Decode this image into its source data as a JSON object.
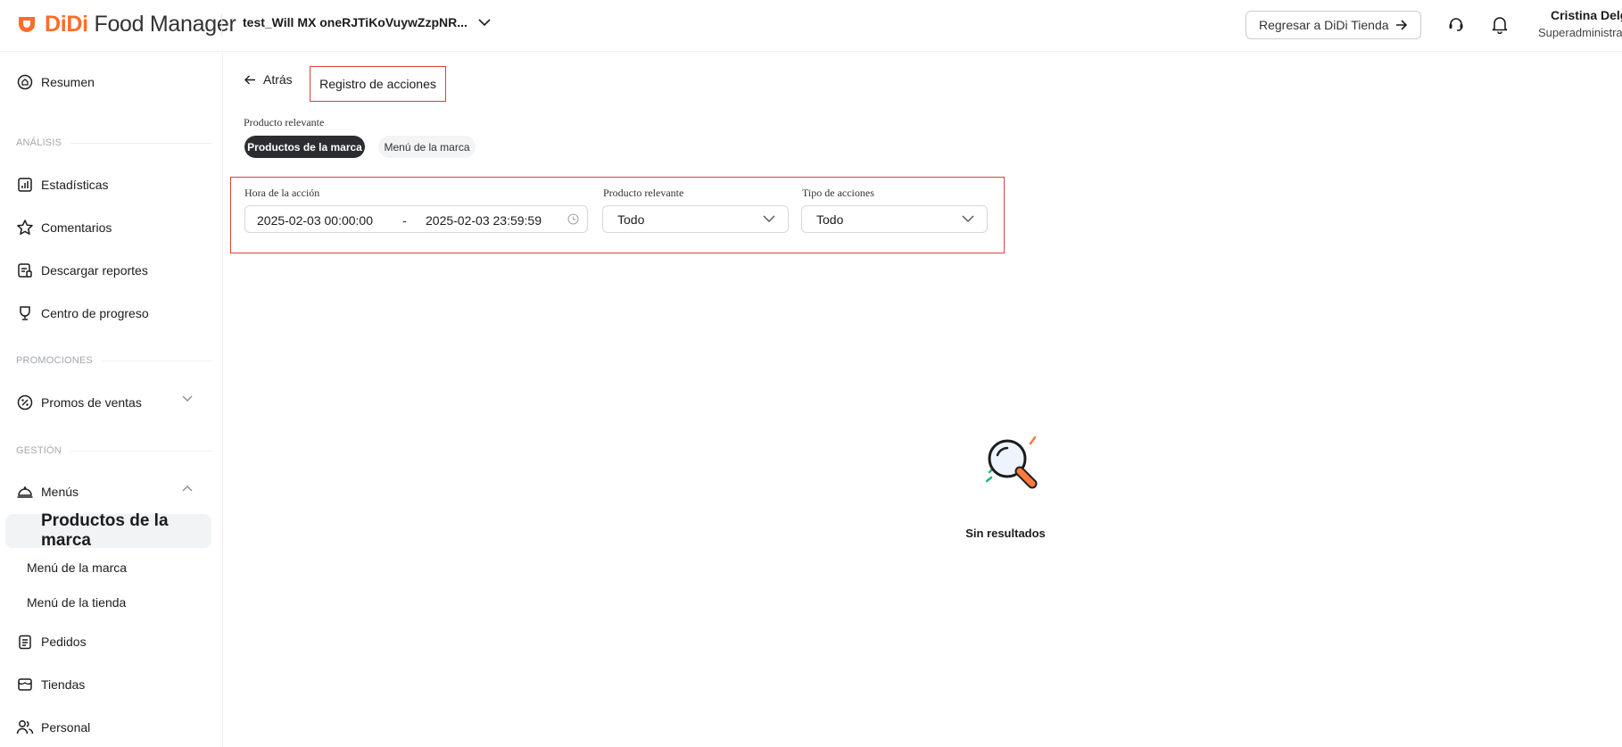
{
  "header": {
    "logo_prefix": "DiDi",
    "logo_suffix": "Food Manager",
    "store_name": "test_Will MX oneRJTiKoVuywZzpNR...",
    "back_store_label": "Regresar a DiDi Tienda",
    "user_name": "Cristina Delg",
    "user_role": "Superadministra",
    "colors": {
      "brand": "#ff6d28"
    }
  },
  "sidebar": {
    "resumen": "Resumen",
    "section_analisis": "ANÁLISIS",
    "estadisticas": "Estadísticas",
    "comentarios": "Comentarios",
    "descargar": "Descargar reportes",
    "progreso": "Centro de progreso",
    "section_promociones": "PROMOCIONES",
    "promos": "Promos de ventas",
    "section_gestion": "GESTIÓN",
    "menus": "Menús",
    "sub_productos": "Productos de la marca",
    "sub_menu_marca": "Menú de la marca",
    "sub_menu_tienda": "Menú de la tienda",
    "pedidos": "Pedidos",
    "tiendas": "Tiendas",
    "personal": "Personal"
  },
  "main": {
    "back_label": "Atrás",
    "page_title": "Registro de acciones",
    "relevant_label": "Producto relevante",
    "tabs": [
      {
        "label": "Productos de la marca",
        "active": true
      },
      {
        "label": "Menú de la marca",
        "active": false
      }
    ],
    "filters": {
      "time_label": "Hora de la acción",
      "date_start": "2025-02-03 00:00:00",
      "date_sep": "-",
      "date_end": "2025-02-03 23:59:59",
      "product_label": "Producto relevante",
      "product_value": "Todo",
      "action_label": "Tipo de acciones",
      "action_value": "Todo"
    },
    "empty_text": "Sin resultados"
  }
}
